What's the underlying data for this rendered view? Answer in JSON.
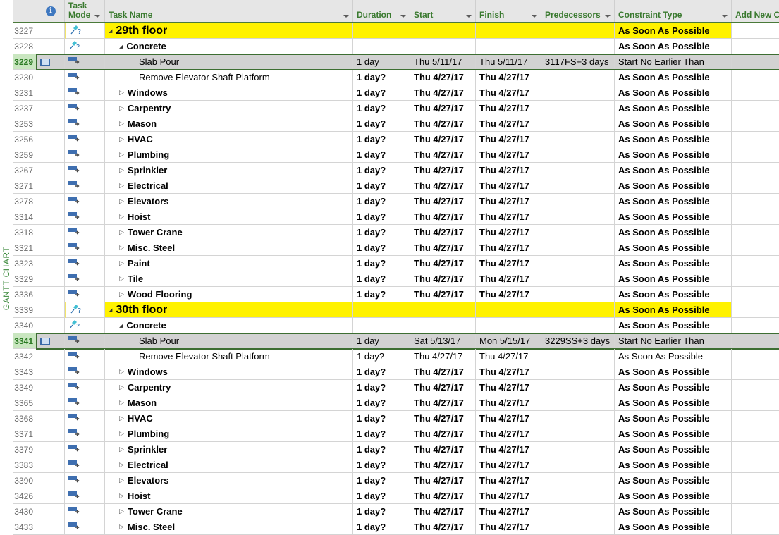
{
  "view_label": "GANTT CHART",
  "columns": [
    {
      "key": "info",
      "label": "",
      "icon": "info-icon"
    },
    {
      "key": "mode",
      "label_line1": "Task",
      "label_line2": "Mode",
      "filter": true
    },
    {
      "key": "name",
      "label": "Task Name",
      "filter": true
    },
    {
      "key": "duration",
      "label": "Duration",
      "filter": true
    },
    {
      "key": "start",
      "label": "Start",
      "filter": true
    },
    {
      "key": "finish",
      "label": "Finish",
      "filter": true
    },
    {
      "key": "pred",
      "label": "Predecessors",
      "filter": true
    },
    {
      "key": "constraint",
      "label": "Constraint Type",
      "filter": true
    },
    {
      "key": "addnew",
      "label": "Add New C"
    }
  ],
  "colors": {
    "header_text": "#3a7a2f",
    "summary_highlight": "#fff200",
    "selected_row": "#d2d2d2",
    "selected_id_bg": "#c9e6c0",
    "selection_border": "#3d6e32"
  },
  "rows": [
    {
      "id": "3227",
      "mode": "manual",
      "level": 0,
      "expand": "collapse",
      "name": "29th floor",
      "type": "floor",
      "duration": "",
      "start": "",
      "finish": "",
      "pred": "",
      "constraint": "As Soon As Possible",
      "bold": true
    },
    {
      "id": "3228",
      "mode": "manual",
      "level": 1,
      "expand": "collapse",
      "name": "Concrete",
      "type": "summary",
      "duration": "",
      "start": "",
      "finish": "",
      "pred": "",
      "constraint": "As Soon As Possible",
      "bold": true
    },
    {
      "id": "3229",
      "mode": "auto",
      "level": 2,
      "expand": "",
      "name": "Slab Pour",
      "type": "task",
      "duration": "1 day",
      "start": "Thu 5/11/17",
      "finish": "Thu 5/11/17",
      "pred": "3117FS+3 days",
      "constraint": "Start No Earlier Than",
      "bold": false,
      "selected": true,
      "indicator": "calendar-icon"
    },
    {
      "id": "3230",
      "mode": "auto",
      "level": 2,
      "expand": "",
      "name": "Remove Elevator Shaft Platform",
      "type": "task",
      "duration": "1 day?",
      "start": "Thu 4/27/17",
      "finish": "Thu 4/27/17",
      "pred": "",
      "constraint": "As Soon As Possible",
      "bold": true,
      "name_normal": true
    },
    {
      "id": "3231",
      "mode": "auto",
      "level": 1,
      "expand": "expand",
      "name": "Windows",
      "type": "summary",
      "duration": "1 day?",
      "start": "Thu 4/27/17",
      "finish": "Thu 4/27/17",
      "pred": "",
      "constraint": "As Soon As Possible",
      "bold": true
    },
    {
      "id": "3237",
      "mode": "auto",
      "level": 1,
      "expand": "expand",
      "name": "Carpentry",
      "type": "summary",
      "duration": "1 day?",
      "start": "Thu 4/27/17",
      "finish": "Thu 4/27/17",
      "pred": "",
      "constraint": "As Soon As Possible",
      "bold": true
    },
    {
      "id": "3253",
      "mode": "auto",
      "level": 1,
      "expand": "expand",
      "name": "Mason",
      "type": "summary",
      "duration": "1 day?",
      "start": "Thu 4/27/17",
      "finish": "Thu 4/27/17",
      "pred": "",
      "constraint": "As Soon As Possible",
      "bold": true
    },
    {
      "id": "3256",
      "mode": "auto",
      "level": 1,
      "expand": "expand",
      "name": "HVAC",
      "type": "summary",
      "duration": "1 day?",
      "start": "Thu 4/27/17",
      "finish": "Thu 4/27/17",
      "pred": "",
      "constraint": "As Soon As Possible",
      "bold": true
    },
    {
      "id": "3259",
      "mode": "auto",
      "level": 1,
      "expand": "expand",
      "name": "Plumbing",
      "type": "summary",
      "duration": "1 day?",
      "start": "Thu 4/27/17",
      "finish": "Thu 4/27/17",
      "pred": "",
      "constraint": "As Soon As Possible",
      "bold": true
    },
    {
      "id": "3267",
      "mode": "auto",
      "level": 1,
      "expand": "expand",
      "name": "Sprinkler",
      "type": "summary",
      "duration": "1 day?",
      "start": "Thu 4/27/17",
      "finish": "Thu 4/27/17",
      "pred": "",
      "constraint": "As Soon As Possible",
      "bold": true
    },
    {
      "id": "3271",
      "mode": "auto",
      "level": 1,
      "expand": "expand",
      "name": "Electrical",
      "type": "summary",
      "duration": "1 day?",
      "start": "Thu 4/27/17",
      "finish": "Thu 4/27/17",
      "pred": "",
      "constraint": "As Soon As Possible",
      "bold": true
    },
    {
      "id": "3278",
      "mode": "auto",
      "level": 1,
      "expand": "expand",
      "name": "Elevators",
      "type": "summary",
      "duration": "1 day?",
      "start": "Thu 4/27/17",
      "finish": "Thu 4/27/17",
      "pred": "",
      "constraint": "As Soon As Possible",
      "bold": true
    },
    {
      "id": "3314",
      "mode": "auto",
      "level": 1,
      "expand": "expand",
      "name": "Hoist",
      "type": "summary",
      "duration": "1 day?",
      "start": "Thu 4/27/17",
      "finish": "Thu 4/27/17",
      "pred": "",
      "constraint": "As Soon As Possible",
      "bold": true
    },
    {
      "id": "3318",
      "mode": "auto",
      "level": 1,
      "expand": "expand",
      "name": "Tower Crane",
      "type": "summary",
      "duration": "1 day?",
      "start": "Thu 4/27/17",
      "finish": "Thu 4/27/17",
      "pred": "",
      "constraint": "As Soon As Possible",
      "bold": true
    },
    {
      "id": "3321",
      "mode": "auto",
      "level": 1,
      "expand": "expand",
      "name": "Misc. Steel",
      "type": "summary",
      "duration": "1 day?",
      "start": "Thu 4/27/17",
      "finish": "Thu 4/27/17",
      "pred": "",
      "constraint": "As Soon As Possible",
      "bold": true
    },
    {
      "id": "3323",
      "mode": "auto",
      "level": 1,
      "expand": "expand",
      "name": "Paint",
      "type": "summary",
      "duration": "1 day?",
      "start": "Thu 4/27/17",
      "finish": "Thu 4/27/17",
      "pred": "",
      "constraint": "As Soon As Possible",
      "bold": true
    },
    {
      "id": "3329",
      "mode": "auto",
      "level": 1,
      "expand": "expand",
      "name": "Tile",
      "type": "summary",
      "duration": "1 day?",
      "start": "Thu 4/27/17",
      "finish": "Thu 4/27/17",
      "pred": "",
      "constraint": "As Soon As Possible",
      "bold": true
    },
    {
      "id": "3336",
      "mode": "auto",
      "level": 1,
      "expand": "expand",
      "name": "Wood Flooring",
      "type": "summary",
      "duration": "1 day?",
      "start": "Thu 4/27/17",
      "finish": "Thu 4/27/17",
      "pred": "",
      "constraint": "As Soon As Possible",
      "bold": true
    },
    {
      "id": "3339",
      "mode": "manual",
      "level": 0,
      "expand": "collapse",
      "name": "30th floor",
      "type": "floor",
      "duration": "",
      "start": "",
      "finish": "",
      "pred": "",
      "constraint": "As Soon As Possible",
      "bold": true
    },
    {
      "id": "3340",
      "mode": "manual",
      "level": 1,
      "expand": "collapse",
      "name": "Concrete",
      "type": "summary",
      "duration": "",
      "start": "",
      "finish": "",
      "pred": "",
      "constraint": "As Soon As Possible",
      "bold": true
    },
    {
      "id": "3341",
      "mode": "auto",
      "level": 2,
      "expand": "",
      "name": "Slab Pour",
      "type": "task",
      "duration": "1 day",
      "start": "Sat 5/13/17",
      "finish": "Mon 5/15/17",
      "pred": "3229SS+3 days",
      "constraint": "Start No Earlier Than",
      "bold": false,
      "selected": true,
      "indicator": "calendar-icon"
    },
    {
      "id": "3342",
      "mode": "auto",
      "level": 2,
      "expand": "",
      "name": "Remove Elevator Shaft Platform",
      "type": "task",
      "duration": "1 day?",
      "start": "Thu 4/27/17",
      "finish": "Thu 4/27/17",
      "pred": "",
      "constraint": "As Soon As Possible",
      "bold": false
    },
    {
      "id": "3343",
      "mode": "auto",
      "level": 1,
      "expand": "expand",
      "name": "Windows",
      "type": "summary",
      "duration": "1 day?",
      "start": "Thu 4/27/17",
      "finish": "Thu 4/27/17",
      "pred": "",
      "constraint": "As Soon As Possible",
      "bold": true
    },
    {
      "id": "3349",
      "mode": "auto",
      "level": 1,
      "expand": "expand",
      "name": "Carpentry",
      "type": "summary",
      "duration": "1 day?",
      "start": "Thu 4/27/17",
      "finish": "Thu 4/27/17",
      "pred": "",
      "constraint": "As Soon As Possible",
      "bold": true
    },
    {
      "id": "3365",
      "mode": "auto",
      "level": 1,
      "expand": "expand",
      "name": "Mason",
      "type": "summary",
      "duration": "1 day?",
      "start": "Thu 4/27/17",
      "finish": "Thu 4/27/17",
      "pred": "",
      "constraint": "As Soon As Possible",
      "bold": true
    },
    {
      "id": "3368",
      "mode": "auto",
      "level": 1,
      "expand": "expand",
      "name": "HVAC",
      "type": "summary",
      "duration": "1 day?",
      "start": "Thu 4/27/17",
      "finish": "Thu 4/27/17",
      "pred": "",
      "constraint": "As Soon As Possible",
      "bold": true
    },
    {
      "id": "3371",
      "mode": "auto",
      "level": 1,
      "expand": "expand",
      "name": "Plumbing",
      "type": "summary",
      "duration": "1 day?",
      "start": "Thu 4/27/17",
      "finish": "Thu 4/27/17",
      "pred": "",
      "constraint": "As Soon As Possible",
      "bold": true
    },
    {
      "id": "3379",
      "mode": "auto",
      "level": 1,
      "expand": "expand",
      "name": "Sprinkler",
      "type": "summary",
      "duration": "1 day?",
      "start": "Thu 4/27/17",
      "finish": "Thu 4/27/17",
      "pred": "",
      "constraint": "As Soon As Possible",
      "bold": true
    },
    {
      "id": "3383",
      "mode": "auto",
      "level": 1,
      "expand": "expand",
      "name": "Electrical",
      "type": "summary",
      "duration": "1 day?",
      "start": "Thu 4/27/17",
      "finish": "Thu 4/27/17",
      "pred": "",
      "constraint": "As Soon As Possible",
      "bold": true
    },
    {
      "id": "3390",
      "mode": "auto",
      "level": 1,
      "expand": "expand",
      "name": "Elevators",
      "type": "summary",
      "duration": "1 day?",
      "start": "Thu 4/27/17",
      "finish": "Thu 4/27/17",
      "pred": "",
      "constraint": "As Soon As Possible",
      "bold": true
    },
    {
      "id": "3426",
      "mode": "auto",
      "level": 1,
      "expand": "expand",
      "name": "Hoist",
      "type": "summary",
      "duration": "1 day?",
      "start": "Thu 4/27/17",
      "finish": "Thu 4/27/17",
      "pred": "",
      "constraint": "As Soon As Possible",
      "bold": true
    },
    {
      "id": "3430",
      "mode": "auto",
      "level": 1,
      "expand": "expand",
      "name": "Tower Crane",
      "type": "summary",
      "duration": "1 day?",
      "start": "Thu 4/27/17",
      "finish": "Thu 4/27/17",
      "pred": "",
      "constraint": "As Soon As Possible",
      "bold": true
    },
    {
      "id": "3433",
      "mode": "auto",
      "level": 1,
      "expand": "expand",
      "name": "Misc. Steel",
      "type": "summary",
      "duration": "1 day?",
      "start": "Thu 4/27/17",
      "finish": "Thu 4/27/17",
      "pred": "",
      "constraint": "As Soon As Possible",
      "bold": true
    }
  ]
}
